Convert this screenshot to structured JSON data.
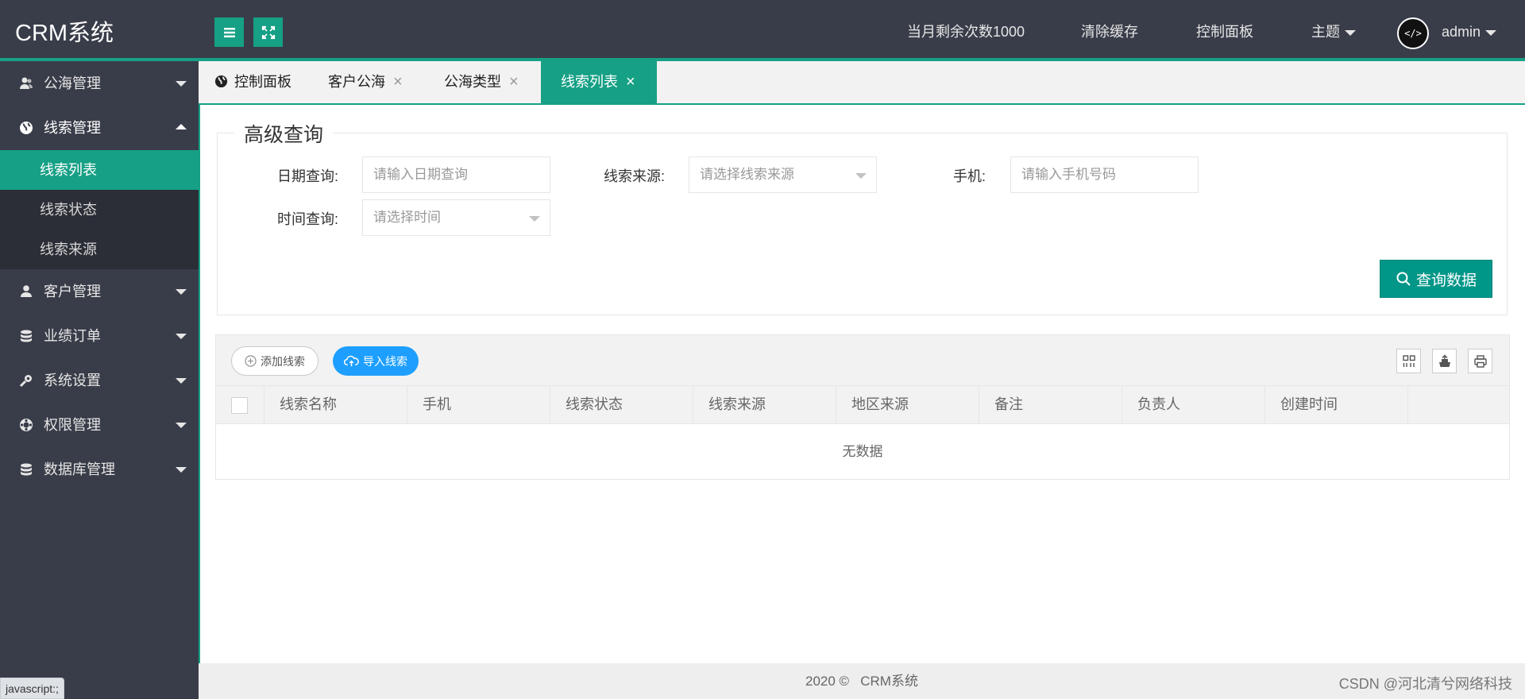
{
  "header": {
    "logo": "CRM系统",
    "nav": {
      "quota": "当月剩余次数1000",
      "clear_cache": "清除缓存",
      "dashboard": "控制面板",
      "theme": "主题",
      "avatar_text": "</>",
      "user": "admin"
    }
  },
  "sidebar": {
    "items": [
      {
        "label": "公海管理"
      },
      {
        "label": "线索管理",
        "sub": [
          "线索列表",
          "线索状态",
          "线索来源"
        ]
      },
      {
        "label": "客户管理"
      },
      {
        "label": "业绩订单"
      },
      {
        "label": "系统设置"
      },
      {
        "label": "权限管理"
      },
      {
        "label": "数据库管理"
      }
    ]
  },
  "tabs": [
    {
      "label": "控制面板"
    },
    {
      "label": "客户公海",
      "close": "×"
    },
    {
      "label": "公海类型",
      "close": "×"
    },
    {
      "label": "线索列表",
      "close": "×"
    }
  ],
  "search": {
    "legend": "高级查询",
    "date_label": "日期查询:",
    "date_placeholder": "请输入日期查询",
    "source_label": "线索来源:",
    "source_placeholder": "请选择线索来源",
    "phone_label": "手机:",
    "phone_placeholder": "请输入手机号码",
    "time_label": "时间查询:",
    "time_placeholder": "请选择时间",
    "query_button": "查询数据"
  },
  "toolbar": {
    "add_label": "添加线索",
    "import_label": "导入线索"
  },
  "table": {
    "columns": [
      "线索名称",
      "手机",
      "线索状态",
      "线索来源",
      "地区来源",
      "备注",
      "负责人",
      "创建时间"
    ],
    "empty": "无数据"
  },
  "footer": {
    "text": "2020 ©   CRM系统"
  },
  "status_bar": "javascript:;",
  "watermark": "CSDN @河北清兮网络科技",
  "colors": {
    "header_bg": "#393d49",
    "accent": "#16a085",
    "primary_button": "#009688",
    "import_button": "#1e9fff"
  }
}
